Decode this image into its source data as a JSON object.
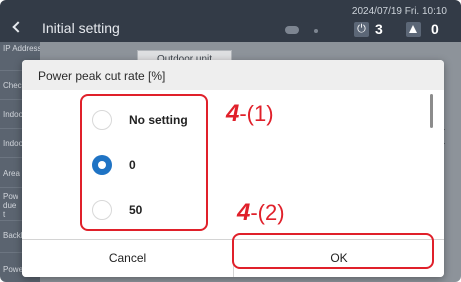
{
  "status_bar": {
    "title": "Initial setting",
    "datetime": "2024/07/19 Fri. 10:10",
    "power_count": "3",
    "warning_count": "0"
  },
  "background": {
    "sidebar_items": [
      "IP Address",
      "Check",
      "Indoo",
      "Indoo",
      "Area s",
      "Powe due t",
      "Backli",
      "Power peak cut"
    ],
    "tab_label": "Outdoor unit"
  },
  "dialog": {
    "title": "Power peak cut rate [%]",
    "options": [
      {
        "label": "No setting",
        "selected": false
      },
      {
        "label": "0",
        "selected": true
      },
      {
        "label": "50",
        "selected": false
      }
    ],
    "cancel_label": "Cancel",
    "ok_label": "OK"
  },
  "annotations": {
    "callout_1": {
      "number": "4",
      "suffix": "-(1)"
    },
    "callout_2": {
      "number": "4",
      "suffix": "-(2)"
    }
  },
  "colors": {
    "accent": "#1f73c4",
    "annotation": "#e0202a",
    "topbar": "#333b47"
  },
  "icons": [
    "back-chevron-icon",
    "camera-icon",
    "power-icon",
    "warning-icon",
    "chevron-down-icon"
  ]
}
